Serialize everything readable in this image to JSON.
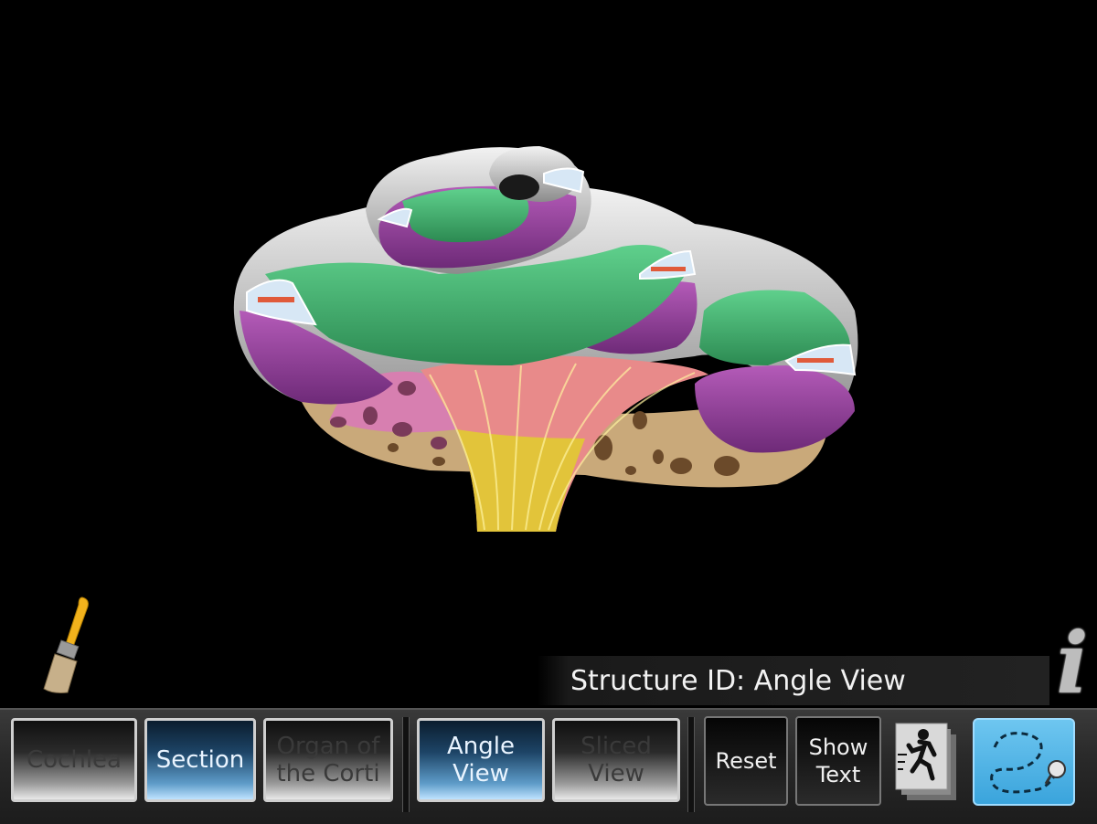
{
  "status": {
    "label": "Structure ID: Angle View"
  },
  "toolbar": {
    "cochlea": "Cochlea",
    "section": "Section",
    "organ_of_corti": "Organ of\nthe Corti",
    "angle_view": "Angle\nView",
    "sliced_view": "Sliced\nView",
    "reset": "Reset",
    "show_text": "Show\nText"
  },
  "icons": {
    "brush": "paint-brush-icon",
    "info": "info-icon",
    "animation": "running-figure-icon",
    "path": "dashed-path-icon"
  },
  "colors": {
    "scala_green": "#3fae6e",
    "scala_purple": "#9a3fa0",
    "bone": "#c9a97a",
    "nerve_yellow": "#e2c43a",
    "nerve_pink": "#e88a8a",
    "shell_gray": "#c9c9c9",
    "active_button": "#5e9cc9"
  }
}
